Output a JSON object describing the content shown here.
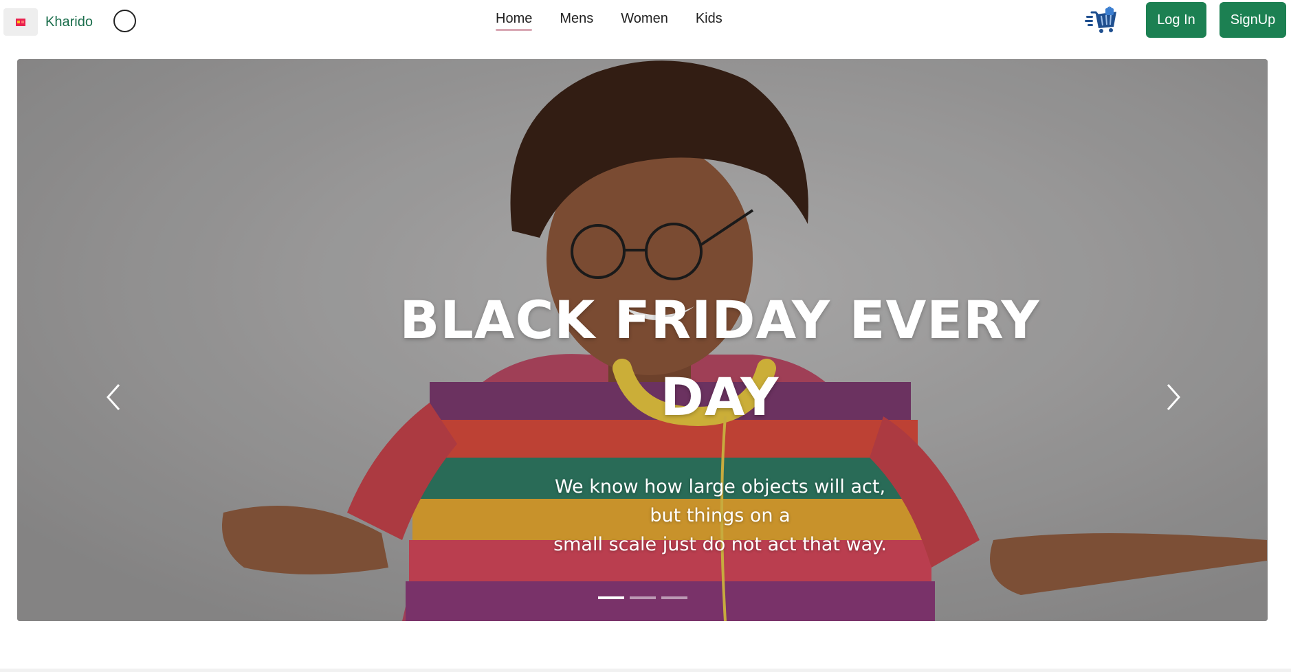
{
  "brand": {
    "name": "Kharido",
    "logo_icon": "shopping-bag-logo-icon"
  },
  "nav": {
    "links": [
      {
        "label": "Home",
        "active": true
      },
      {
        "label": "Mens",
        "active": false
      },
      {
        "label": "Women",
        "active": false
      },
      {
        "label": "Kids",
        "active": false
      }
    ],
    "cart_icon": "shopping-cart-icon",
    "login_label": "Log In",
    "signup_label": "SignUp"
  },
  "hero": {
    "title": "BLACK FRIDAY EVERY DAY",
    "subtitle_lines": [
      "We know how large objects will act,",
      "but things on a",
      "small scale just do not act that way."
    ],
    "slide_count": 3,
    "active_slide": 1
  },
  "colors": {
    "brand_green": "#1c8052",
    "brand_text": "#1b6e4c",
    "active_underline": "#d9a8b4",
    "cart_blue": "#1f4f8f"
  }
}
